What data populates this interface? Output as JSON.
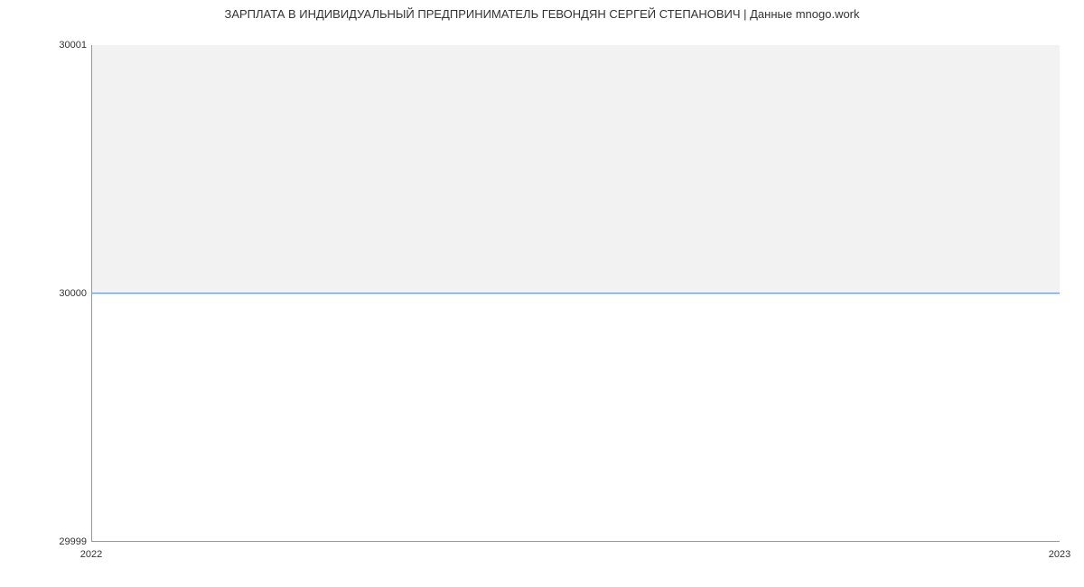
{
  "chart_data": {
    "type": "area",
    "title": "ЗАРПЛАТА В ИНДИВИДУАЛЬНЫЙ ПРЕДПРИНИМАТЕЛЬ ГЕВОНДЯН СЕРГЕЙ СТЕПАНОВИЧ | Данные mnogo.work",
    "x": [
      2022,
      2023
    ],
    "values": [
      30000,
      30000
    ],
    "xlabel": "",
    "ylabel": "",
    "ylim": [
      29999,
      30001
    ],
    "xlim": [
      2022,
      2023
    ],
    "y_ticks": [
      29999,
      30000,
      30001
    ],
    "x_ticks": [
      2022,
      2023
    ],
    "series_color": "#4a7bc8",
    "fill_color": "#f2f2f2"
  },
  "labels": {
    "y_top": "30001",
    "y_mid": "30000",
    "y_bottom": "29999",
    "x_left": "2022",
    "x_right": "2023"
  }
}
